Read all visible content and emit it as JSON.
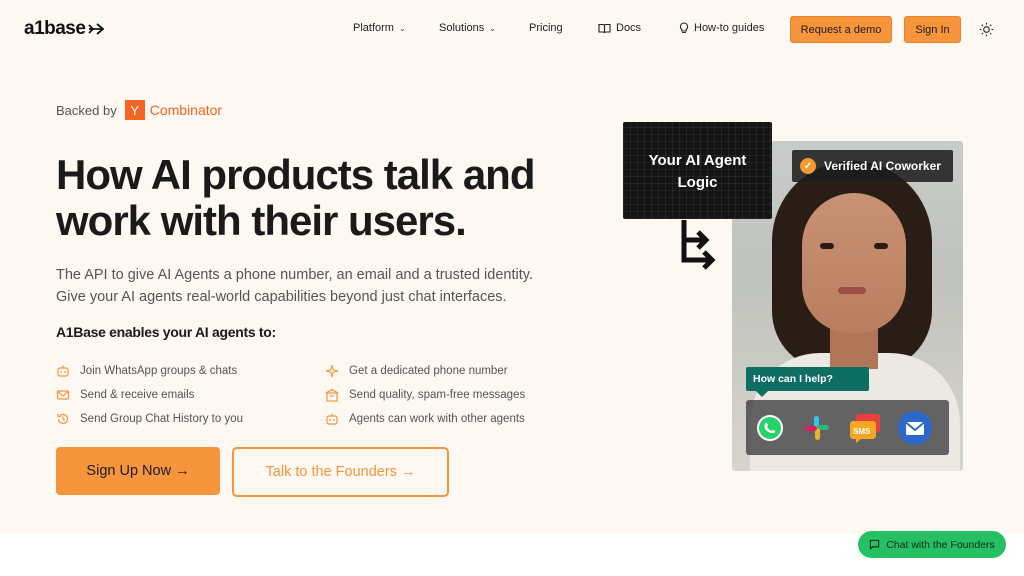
{
  "brand": {
    "logo_text": "a1base"
  },
  "nav": {
    "items": [
      {
        "label": "Platform",
        "has_chevron": true
      },
      {
        "label": "Solutions",
        "has_chevron": true
      },
      {
        "label": "Pricing",
        "has_chevron": false
      },
      {
        "label": "Docs",
        "icon": "book-icon"
      },
      {
        "label": "How-to guides",
        "icon": "lightbulb-icon"
      }
    ],
    "demo_label": "Request a demo",
    "signin_label": "Sign In",
    "theme_icon": "sun-icon"
  },
  "hero": {
    "backed_by": "Backed by",
    "yc_letter": "Y",
    "yc_name": "Combinator",
    "headline_line1": "How AI products talk and",
    "headline_line2": "work with their users.",
    "subtitle_line1": "The API to give AI Agents a phone number, an email and a trusted identity.",
    "subtitle_line2": "Give your AI agents real-world capabilities beyond just chat interfaces.",
    "enables_title": "A1Base enables your AI agents to:",
    "features": [
      {
        "label": "Join WhatsApp groups & chats",
        "icon": "robot-icon"
      },
      {
        "label": "Get a dedicated phone number",
        "icon": "sparkle-icon"
      },
      {
        "label": "Send & receive emails",
        "icon": "mail-icon"
      },
      {
        "label": "Send quality, spam-free messages",
        "icon": "building-icon"
      },
      {
        "label": "Send Group Chat History to you",
        "icon": "history-icon"
      },
      {
        "label": "Agents can work with other agents",
        "icon": "robot-icon"
      }
    ],
    "signup_label": "Sign Up Now →",
    "talk_label": "Talk to the Founders →"
  },
  "visual": {
    "agent_card_line1": "Your AI Agent",
    "agent_card_line2": "Logic",
    "verified_label": "Verified AI Coworker",
    "help_bubble": "How can I help?",
    "apps": [
      "whatsapp-icon",
      "slack-icon",
      "sms-icon",
      "email-icon"
    ],
    "sms_text": "SMS"
  },
  "chat_widget": {
    "label": "Chat with the Founders"
  },
  "colors": {
    "accent": "#f7953c",
    "yc": "#f26522",
    "chat": "#24c063",
    "bubble": "#0f6e63",
    "background": "#fdf8f1"
  }
}
